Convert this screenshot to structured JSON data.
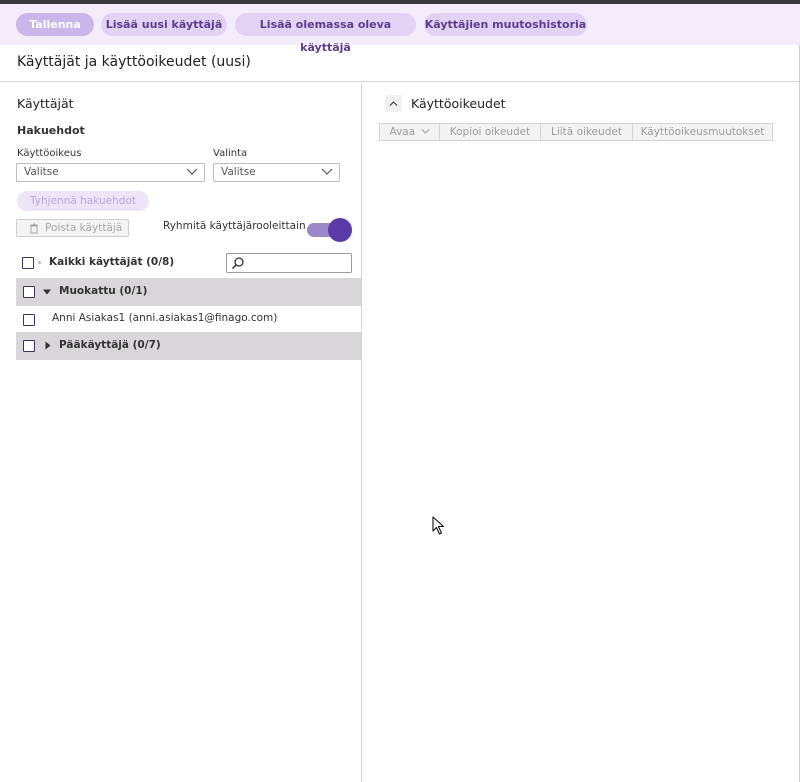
{
  "toolbar": {
    "save": "Tallenna",
    "add_new_user": "Lisää uusi käyttäjä",
    "add_existing_user": "Lisää olemassa oleva käyttäjä",
    "history": "Käyttäjien muutoshistoria"
  },
  "page": {
    "title": "Käyttäjät ja käyttöoikeudet (uusi)"
  },
  "users_panel": {
    "title": "Käyttäjät",
    "filters_title": "Hakuehdot",
    "permission_label": "Käyttöoikeus",
    "permission_value": "Valitse",
    "selection_label": "Valinta",
    "selection_value": "Valitse",
    "clear_filters": "Tyhjennä hakuehdot",
    "delete_user": "Poista käyttäjä",
    "group_by_role": "Ryhmitä käyttäjärooleittain",
    "group_by_role_on": true,
    "all_users": "Kaikki käyttäjät (0/8)",
    "search_placeholder": "",
    "groups": [
      {
        "label": "Muokattu (0/1)",
        "expanded": true,
        "users": [
          "Anni Asiakas1 (anni.asiakas1@finago.com)"
        ]
      },
      {
        "label": "Pääkäyttäjä (0/7)",
        "expanded": false,
        "users": []
      }
    ]
  },
  "rights_panel": {
    "title": "Käyttöoikeudet",
    "buttons": {
      "open": "Avaa",
      "copy": "Kopioi oikeudet",
      "paste": "Liitä oikeudet",
      "changes": "Käyttöoikeusmuutokset"
    }
  },
  "colors": {
    "accent": "#5a3aa8",
    "toolbar_bg": "#f3ecfb",
    "button_bg": "#e2d3f5",
    "group_row_bg": "#d8d6d8"
  }
}
